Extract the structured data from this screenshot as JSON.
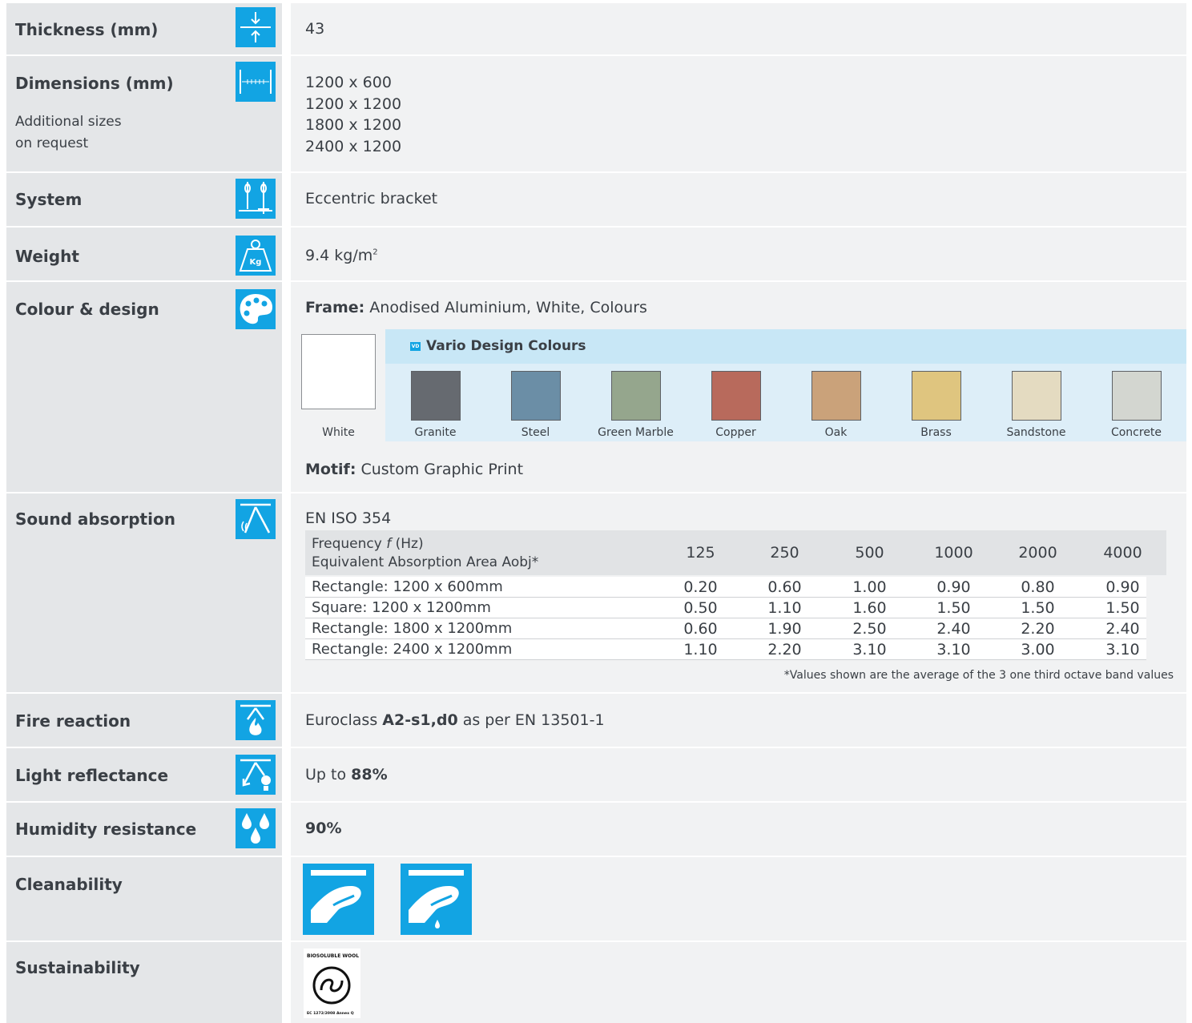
{
  "rows": {
    "thickness": {
      "label": "Thickness (mm)",
      "value": "43",
      "icon": "thickness-icon"
    },
    "dimensions": {
      "label": "Dimensions (mm)",
      "sub_line1": "Additional sizes",
      "sub_line2": "on request",
      "values": [
        "1200 x 600",
        "1200 x 1200",
        "1800 x 1200",
        "2400 x 1200"
      ],
      "icon": "dimensions-icon"
    },
    "system": {
      "label": "System",
      "value": "Eccentric bracket",
      "icon": "bracket-system-icon"
    },
    "weight": {
      "label": "Weight",
      "value": "9.4 kg/m",
      "value_sup": "2",
      "icon": "weight-kg-icon",
      "icon_text": "Kg"
    },
    "colour": {
      "label": "Colour & design",
      "frame_label": "Frame:",
      "frame_value": "Anodised Aluminium, White, Colours",
      "white_label": "White",
      "vario_badge": "VD",
      "vario_title": "Vario Design Colours",
      "swatches": [
        {
          "name": "Granite",
          "color": "#666a70"
        },
        {
          "name": "Steel",
          "color": "#6b8ea6"
        },
        {
          "name": "Green Marble",
          "color": "#95a68d"
        },
        {
          "name": "Copper",
          "color": "#b86a5c"
        },
        {
          "name": "Oak",
          "color": "#caa27a"
        },
        {
          "name": "Brass",
          "color": "#dfc57f"
        },
        {
          "name": "Sandstone",
          "color": "#e4dbc1"
        },
        {
          "name": "Concrete",
          "color": "#d3d6d0"
        }
      ],
      "motif_label": "Motif:",
      "motif_value": "Custom Graphic Print",
      "icon": "palette-icon"
    },
    "sound": {
      "label": "Sound absorption",
      "standard": "EN ISO 354",
      "header_line1_pre": "Frequency ",
      "header_line1_italic": "f",
      "header_line1_post": " (Hz)",
      "header_line2": "Equivalent Absorption Area Aobj*",
      "frequencies": [
        "125",
        "250",
        "500",
        "1000",
        "2000",
        "4000"
      ],
      "table": [
        {
          "name": "Rectangle: 1200 x 600mm",
          "values": [
            "0.20",
            "0.60",
            "1.00",
            "0.90",
            "0.80",
            "0.90"
          ]
        },
        {
          "name": "Square: 1200 x 1200mm",
          "values": [
            "0.50",
            "1.10",
            "1.60",
            "1.50",
            "1.50",
            "1.50"
          ]
        },
        {
          "name": "Rectangle: 1800 x 1200mm",
          "values": [
            "0.60",
            "1.90",
            "2.50",
            "2.40",
            "2.20",
            "2.40"
          ]
        },
        {
          "name": "Rectangle: 2400 x 1200mm",
          "values": [
            "1.10",
            "2.20",
            "3.10",
            "3.10",
            "3.00",
            "3.10"
          ]
        }
      ],
      "footnote": "*Values shown are the average of the 3 one third octave band values",
      "icon": "sound-absorption-icon"
    },
    "fire": {
      "label": "Fire reaction",
      "pre": "Euroclass ",
      "bold": "A2-s1,d0",
      "post": " as per EN 13501-1",
      "icon": "fire-reaction-icon"
    },
    "light": {
      "label": "Light reflectance",
      "pre": "Up to ",
      "bold": "88%",
      "icon": "light-reflectance-icon"
    },
    "humidity": {
      "label": "Humidity resistance",
      "bold": "90%",
      "icon": "humidity-drops-icon"
    },
    "cleanability": {
      "label": "Cleanability",
      "icons": [
        "dry-cleaning-icon",
        "wet-cleaning-icon"
      ]
    },
    "sustainability": {
      "label": "Sustainability",
      "logo_top": "BIOSOLUBLE WOOL",
      "logo_bottom": "EC 1272/2008 Annex Q",
      "icon": "biosoluble-wool-logo"
    }
  },
  "colors": {
    "accent": "#12a4e3",
    "label_bg": "#e4e6e8",
    "value_bg": "#f1f2f3",
    "text": "#3a3f45"
  }
}
